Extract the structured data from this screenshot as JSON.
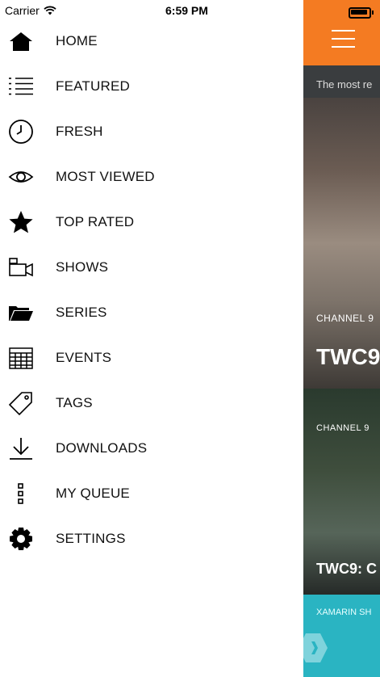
{
  "status_bar": {
    "carrier": "Carrier",
    "time": "6:59 PM"
  },
  "menu": [
    {
      "label": "HOME",
      "icon": "home-icon"
    },
    {
      "label": "FEATURED",
      "icon": "list-icon"
    },
    {
      "label": "FRESH",
      "icon": "clock-icon"
    },
    {
      "label": "MOST VIEWED",
      "icon": "eye-icon"
    },
    {
      "label": "TOP RATED",
      "icon": "star-icon"
    },
    {
      "label": "SHOWS",
      "icon": "video-camera-icon"
    },
    {
      "label": "SERIES",
      "icon": "folder-icon"
    },
    {
      "label": "EVENTS",
      "icon": "calendar-grid-icon"
    },
    {
      "label": "TAGS",
      "icon": "tag-icon"
    },
    {
      "label": "DOWNLOADS",
      "icon": "download-icon"
    },
    {
      "label": "MY QUEUE",
      "icon": "queue-icon"
    },
    {
      "label": "SETTINGS",
      "icon": "gear-icon"
    }
  ],
  "content": {
    "accent_color": "#F47B22",
    "subtitle": "The most re",
    "cards": [
      {
        "kicker": "CHANNEL 9",
        "title": "TWC9"
      },
      {
        "kicker": "CHANNEL 9",
        "title": "TWC9: C"
      },
      {
        "kicker": "XAMARIN SH"
      }
    ]
  }
}
